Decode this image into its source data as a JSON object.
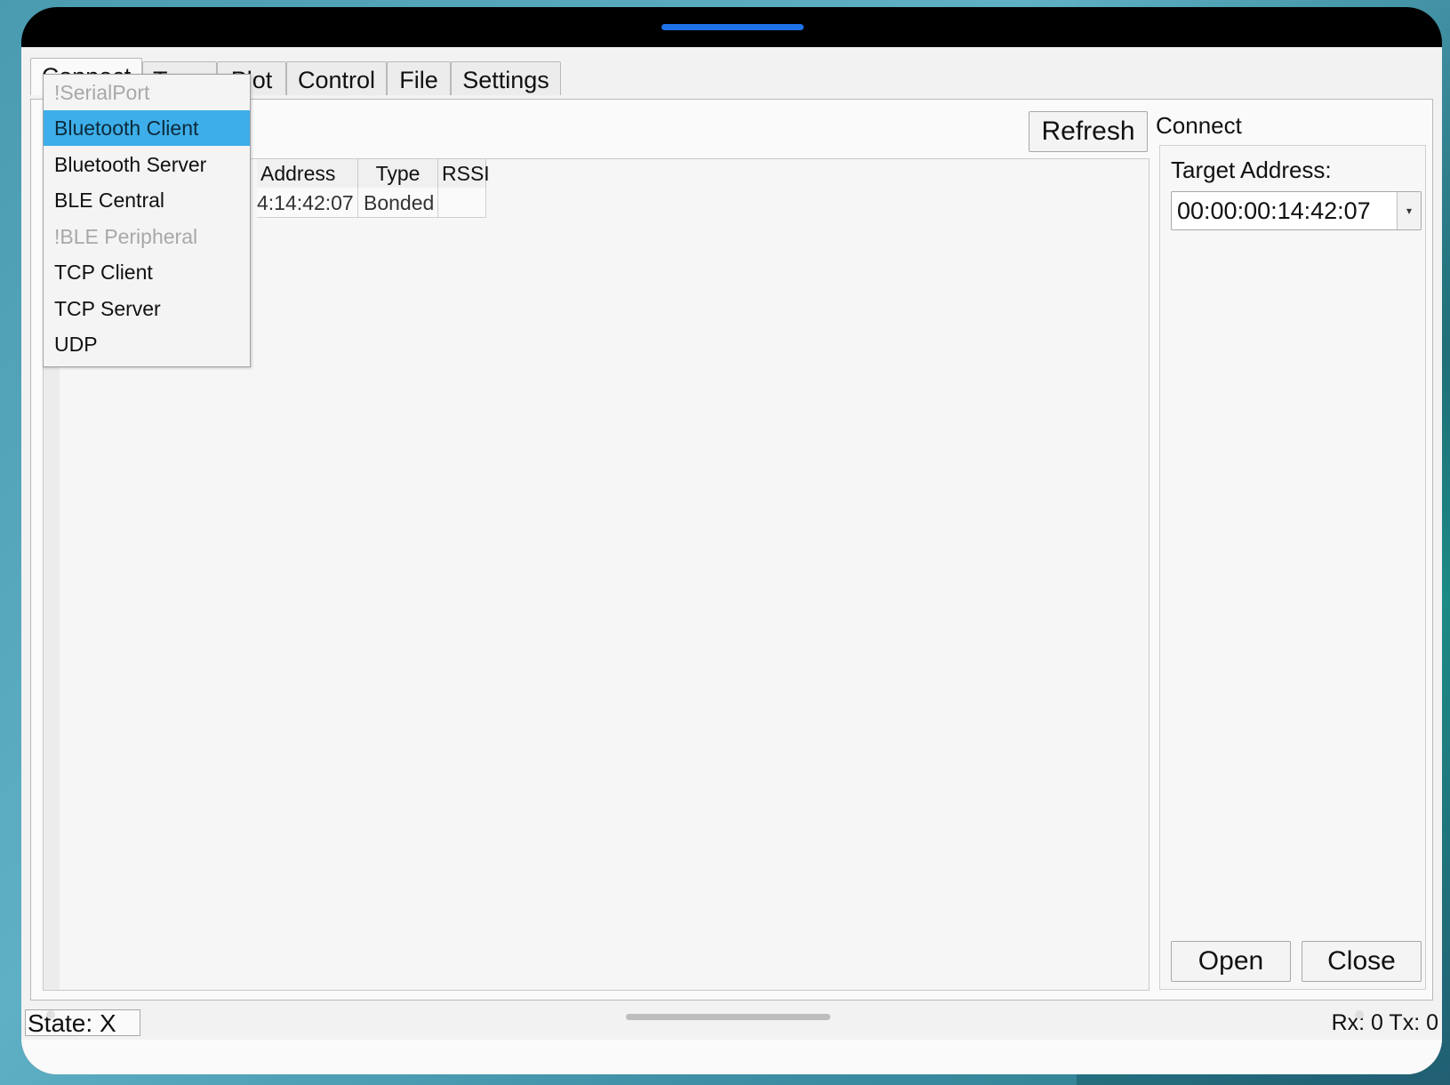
{
  "tabs": [
    {
      "label": "Connect"
    },
    {
      "label": "Term"
    },
    {
      "label": "Plot"
    },
    {
      "label": "Control"
    },
    {
      "label": "File"
    },
    {
      "label": "Settings"
    }
  ],
  "dropdown": {
    "items": [
      {
        "label": "!SerialPort",
        "state": "disabled"
      },
      {
        "label": "Bluetooth Client",
        "state": "selected"
      },
      {
        "label": "Bluetooth Server",
        "state": "normal"
      },
      {
        "label": "BLE Central",
        "state": "normal"
      },
      {
        "label": "!BLE Peripheral",
        "state": "disabled"
      },
      {
        "label": "TCP Client",
        "state": "normal"
      },
      {
        "label": "TCP Server",
        "state": "normal"
      },
      {
        "label": "UDP",
        "state": "normal"
      }
    ]
  },
  "toolbar": {
    "refresh_label": "Refresh"
  },
  "device_list": {
    "columns": [
      "Address",
      "Type",
      "RSSI"
    ],
    "rows": [
      {
        "address": "4:14:42:07",
        "type": "Bonded",
        "rssi": ""
      }
    ]
  },
  "connect": {
    "title": "Connect",
    "target_label": "Target Address:",
    "target_value": "00:00:00:14:42:07",
    "open_label": "Open",
    "close_label": "Close"
  },
  "status": {
    "state": "State: X",
    "rxtx": "Rx: 0  Tx: 0"
  },
  "colors": {
    "accent": "#3daee9",
    "status_pill": "#1e72e8"
  }
}
